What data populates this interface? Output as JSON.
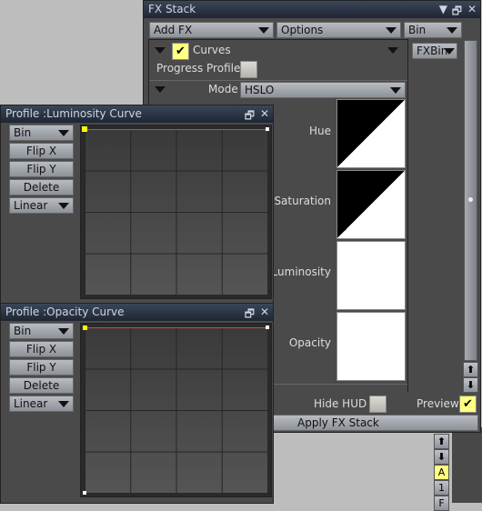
{
  "fx_stack": {
    "title": "FX Stack",
    "toolbar": {
      "add_fx": "Add FX",
      "options": "Options",
      "bin": "Bin"
    },
    "fx_bin": "FXBin",
    "effect": {
      "name": "Curves",
      "enabled": true,
      "progress_profile_label": "Progress Profile",
      "progress_profile": false
    },
    "mode": {
      "label": "Mode",
      "value": "HSLO"
    },
    "curves": [
      {
        "label": "Hue"
      },
      {
        "label": "Saturation"
      },
      {
        "label": "Luminosity"
      },
      {
        "label": "Opacity"
      }
    ],
    "hide_hud_label": "Hide HUD",
    "hide_hud": false,
    "preview_label": "Preview",
    "preview": true,
    "apply_label": "Apply FX Stack"
  },
  "side_buttons": {
    "up": "⬆",
    "down": "⬇",
    "a": "A",
    "one": "1",
    "f": "F"
  },
  "profiles": [
    {
      "title": "Profile :Luminosity Curve",
      "bin": "Bin",
      "flip_x": "Flip X",
      "flip_y": "Flip Y",
      "delete": "Delete",
      "interp": "Linear"
    },
    {
      "title": "Profile :Opacity Curve",
      "bin": "Bin",
      "flip_x": "Flip X",
      "flip_y": "Flip Y",
      "delete": "Delete",
      "interp": "Linear"
    }
  ],
  "colors": {
    "accent": "#ffff80",
    "curve_line": "#e04040",
    "title_bar": "#2a3444"
  }
}
